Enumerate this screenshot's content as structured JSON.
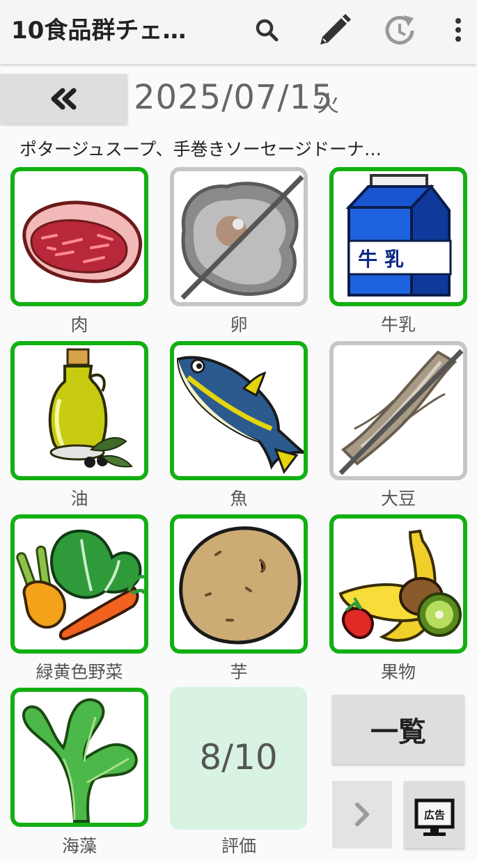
{
  "app": {
    "title": "10食品群チェ…"
  },
  "toolbar": {
    "search_icon": "search-icon",
    "edit_icon": "pencil-icon",
    "history_icon": "history-icon",
    "more_icon": "more-vert-icon"
  },
  "nav": {
    "prev_icon": "double-chevron-left-icon",
    "date": "2025/07/15",
    "weekday": "火"
  },
  "meal": {
    "text": "ポタージュスープ、手巻きソーセージドーナ…"
  },
  "groups": [
    {
      "name": "肉",
      "checked": true,
      "icon": "meat-icon"
    },
    {
      "name": "卵",
      "checked": false,
      "icon": "egg-icon"
    },
    {
      "name": "牛乳",
      "checked": true,
      "icon": "milk-carton-icon",
      "carton_text": "牛 乳"
    },
    {
      "name": "油",
      "checked": true,
      "icon": "oil-bottle-icon"
    },
    {
      "name": "魚",
      "checked": true,
      "icon": "fish-icon"
    },
    {
      "name": "大豆",
      "checked": false,
      "icon": "soybean-icon"
    },
    {
      "name": "緑黄色野菜",
      "checked": true,
      "icon": "vegetables-icon"
    },
    {
      "name": "芋",
      "checked": true,
      "icon": "potato-icon"
    },
    {
      "name": "果物",
      "checked": true,
      "icon": "fruits-icon"
    },
    {
      "name": "海藻",
      "checked": true,
      "icon": "seaweed-icon"
    }
  ],
  "score": {
    "value": "8/10",
    "label": "評価"
  },
  "buttons": {
    "list": "一覧",
    "next_icon": "chevron-right-icon",
    "ad_icon": "ad-monitor-icon",
    "ad_label": "広告"
  },
  "colors": {
    "checked_border": "#12b012",
    "unchecked_border": "#c6c6c6",
    "score_bg": "#d9f3e3"
  }
}
